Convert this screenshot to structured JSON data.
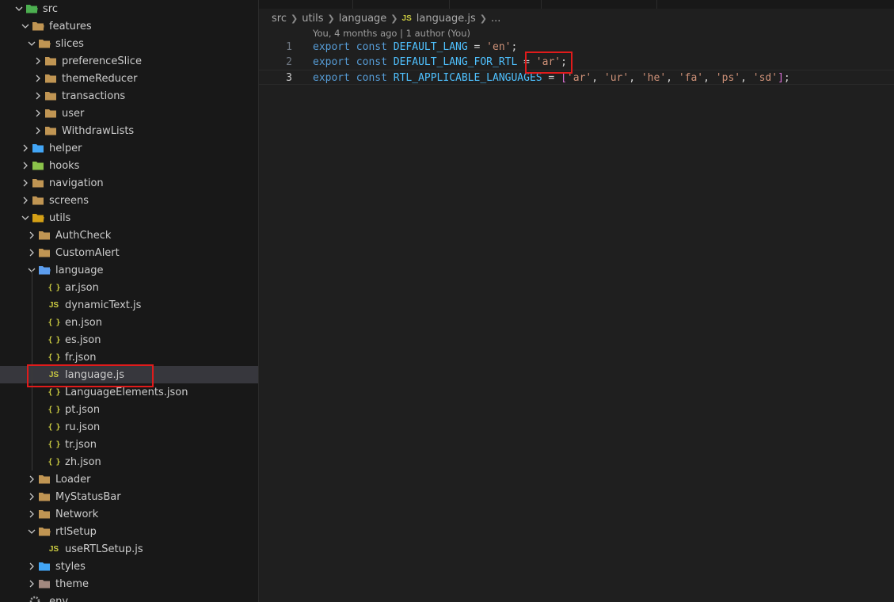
{
  "explorer": {
    "items": [
      {
        "label": "src",
        "level": 1,
        "kind": "folder",
        "expanded": true,
        "icon": "src-folder-icon",
        "color": "#4caf50"
      },
      {
        "label": "features",
        "level": 2,
        "kind": "folder",
        "expanded": true,
        "icon": "folder-open-icon",
        "color": "#c09553"
      },
      {
        "label": "slices",
        "level": 3,
        "kind": "folder",
        "expanded": true,
        "icon": "folder-open-icon",
        "color": "#c09553"
      },
      {
        "label": "preferenceSlice",
        "level": 4,
        "kind": "folder",
        "expanded": false,
        "icon": "folder-icon",
        "color": "#c09553"
      },
      {
        "label": "themeReducer",
        "level": 4,
        "kind": "folder",
        "expanded": false,
        "icon": "folder-icon",
        "color": "#c09553"
      },
      {
        "label": "transactions",
        "level": 4,
        "kind": "folder",
        "expanded": false,
        "icon": "folder-icon",
        "color": "#c09553"
      },
      {
        "label": "user",
        "level": 4,
        "kind": "folder",
        "expanded": false,
        "icon": "folder-icon",
        "color": "#c09553"
      },
      {
        "label": "WithdrawLists",
        "level": 4,
        "kind": "folder",
        "expanded": false,
        "icon": "folder-icon",
        "color": "#c09553"
      },
      {
        "label": "helper",
        "level": 2,
        "kind": "folder",
        "expanded": false,
        "icon": "helper-folder-icon",
        "color": "#42a5f5"
      },
      {
        "label": "hooks",
        "level": 2,
        "kind": "folder",
        "expanded": false,
        "icon": "hooks-folder-icon",
        "color": "#8bc34a"
      },
      {
        "label": "navigation",
        "level": 2,
        "kind": "folder",
        "expanded": false,
        "icon": "folder-icon",
        "color": "#c09553"
      },
      {
        "label": "screens",
        "level": 2,
        "kind": "folder",
        "expanded": false,
        "icon": "folder-icon",
        "color": "#c09553"
      },
      {
        "label": "utils",
        "level": 2,
        "kind": "folder",
        "expanded": true,
        "icon": "utils-folder-icon",
        "color": "#d4a017"
      },
      {
        "label": "AuthCheck",
        "level": 3,
        "kind": "folder",
        "expanded": false,
        "icon": "folder-icon",
        "color": "#c09553"
      },
      {
        "label": "CustomAlert",
        "level": 3,
        "kind": "folder",
        "expanded": false,
        "icon": "folder-icon",
        "color": "#c09553"
      },
      {
        "label": "language",
        "level": 3,
        "kind": "folder",
        "expanded": true,
        "icon": "language-folder-icon",
        "color": "#5c9ded"
      },
      {
        "label": "ar.json",
        "level": 4,
        "kind": "json",
        "icon": "json-icon"
      },
      {
        "label": "dynamicText.js",
        "level": 4,
        "kind": "js",
        "icon": "js-icon"
      },
      {
        "label": "en.json",
        "level": 4,
        "kind": "json",
        "icon": "json-icon"
      },
      {
        "label": "es.json",
        "level": 4,
        "kind": "json",
        "icon": "json-icon"
      },
      {
        "label": "fr.json",
        "level": 4,
        "kind": "json",
        "icon": "json-icon"
      },
      {
        "label": "language.js",
        "level": 4,
        "kind": "js",
        "icon": "js-icon",
        "selected": true
      },
      {
        "label": "LanguageElements.json",
        "level": 4,
        "kind": "json",
        "icon": "json-icon"
      },
      {
        "label": "pt.json",
        "level": 4,
        "kind": "json",
        "icon": "json-icon"
      },
      {
        "label": "ru.json",
        "level": 4,
        "kind": "json",
        "icon": "json-icon"
      },
      {
        "label": "tr.json",
        "level": 4,
        "kind": "json",
        "icon": "json-icon"
      },
      {
        "label": "zh.json",
        "level": 4,
        "kind": "json",
        "icon": "json-icon"
      },
      {
        "label": "Loader",
        "level": 3,
        "kind": "folder",
        "expanded": false,
        "icon": "folder-icon",
        "color": "#c09553"
      },
      {
        "label": "MyStatusBar",
        "level": 3,
        "kind": "folder",
        "expanded": false,
        "icon": "folder-icon",
        "color": "#c09553"
      },
      {
        "label": "Network",
        "level": 3,
        "kind": "folder",
        "expanded": false,
        "icon": "folder-icon",
        "color": "#c09553"
      },
      {
        "label": "rtlSetup",
        "level": 3,
        "kind": "folder",
        "expanded": true,
        "icon": "folder-open-icon",
        "color": "#c09553"
      },
      {
        "label": "useRTLSetup.js",
        "level": 4,
        "kind": "js",
        "icon": "js-icon"
      },
      {
        "label": "styles",
        "level": 3,
        "kind": "folder",
        "expanded": false,
        "icon": "styles-folder-icon",
        "color": "#42a5f5"
      },
      {
        "label": "theme",
        "level": 3,
        "kind": "folder",
        "expanded": false,
        "icon": "theme-folder-icon",
        "color": "#a1887f"
      },
      {
        "label": ".env",
        "level": 1,
        "kind": "file",
        "icon": "gear-icon"
      }
    ]
  },
  "editor": {
    "breadcrumb": [
      "src",
      "utils",
      "language",
      "language.js",
      "..."
    ],
    "breadcrumb_file_icon": "JS",
    "codelens": "You, 4 months ago | 1 author (You)",
    "lines": [
      {
        "num": "1",
        "tokens": [
          [
            "kw",
            "export"
          ],
          [
            "op",
            " "
          ],
          [
            "kw",
            "const"
          ],
          [
            "op",
            " "
          ],
          [
            "const",
            "DEFAULT_LANG"
          ],
          [
            "op",
            " = "
          ],
          [
            "str",
            "'en'"
          ],
          [
            "op",
            ";"
          ]
        ]
      },
      {
        "num": "2",
        "tokens": [
          [
            "kw",
            "export"
          ],
          [
            "op",
            " "
          ],
          [
            "kw",
            "const"
          ],
          [
            "op",
            " "
          ],
          [
            "const",
            "DEFAULT_LANG_FOR_RTL"
          ],
          [
            "op",
            " = "
          ],
          [
            "str",
            "'ar'"
          ],
          [
            "op",
            ";"
          ]
        ]
      },
      {
        "num": "3",
        "tokens": [
          [
            "kw",
            "export"
          ],
          [
            "op",
            " "
          ],
          [
            "kw",
            "const"
          ],
          [
            "op",
            " "
          ],
          [
            "const",
            "RTL_APPLICABLE_LANGUAGES"
          ],
          [
            "op",
            " = "
          ],
          [
            "brk",
            "["
          ],
          [
            "str",
            "'ar'"
          ],
          [
            "op",
            ", "
          ],
          [
            "str",
            "'ur'"
          ],
          [
            "op",
            ", "
          ],
          [
            "str",
            "'he'"
          ],
          [
            "op",
            ", "
          ],
          [
            "str",
            "'fa'"
          ],
          [
            "op",
            ", "
          ],
          [
            "str",
            "'ps'"
          ],
          [
            "op",
            ", "
          ],
          [
            "str",
            "'sd'"
          ],
          [
            "brk",
            "]"
          ],
          [
            "op",
            ";"
          ]
        ]
      }
    ]
  },
  "colors": {
    "sidebar_bg": "#181818",
    "editor_bg": "#1f1f1f",
    "selection_bg": "#37373d",
    "annotation_red": "#e01b1b"
  }
}
